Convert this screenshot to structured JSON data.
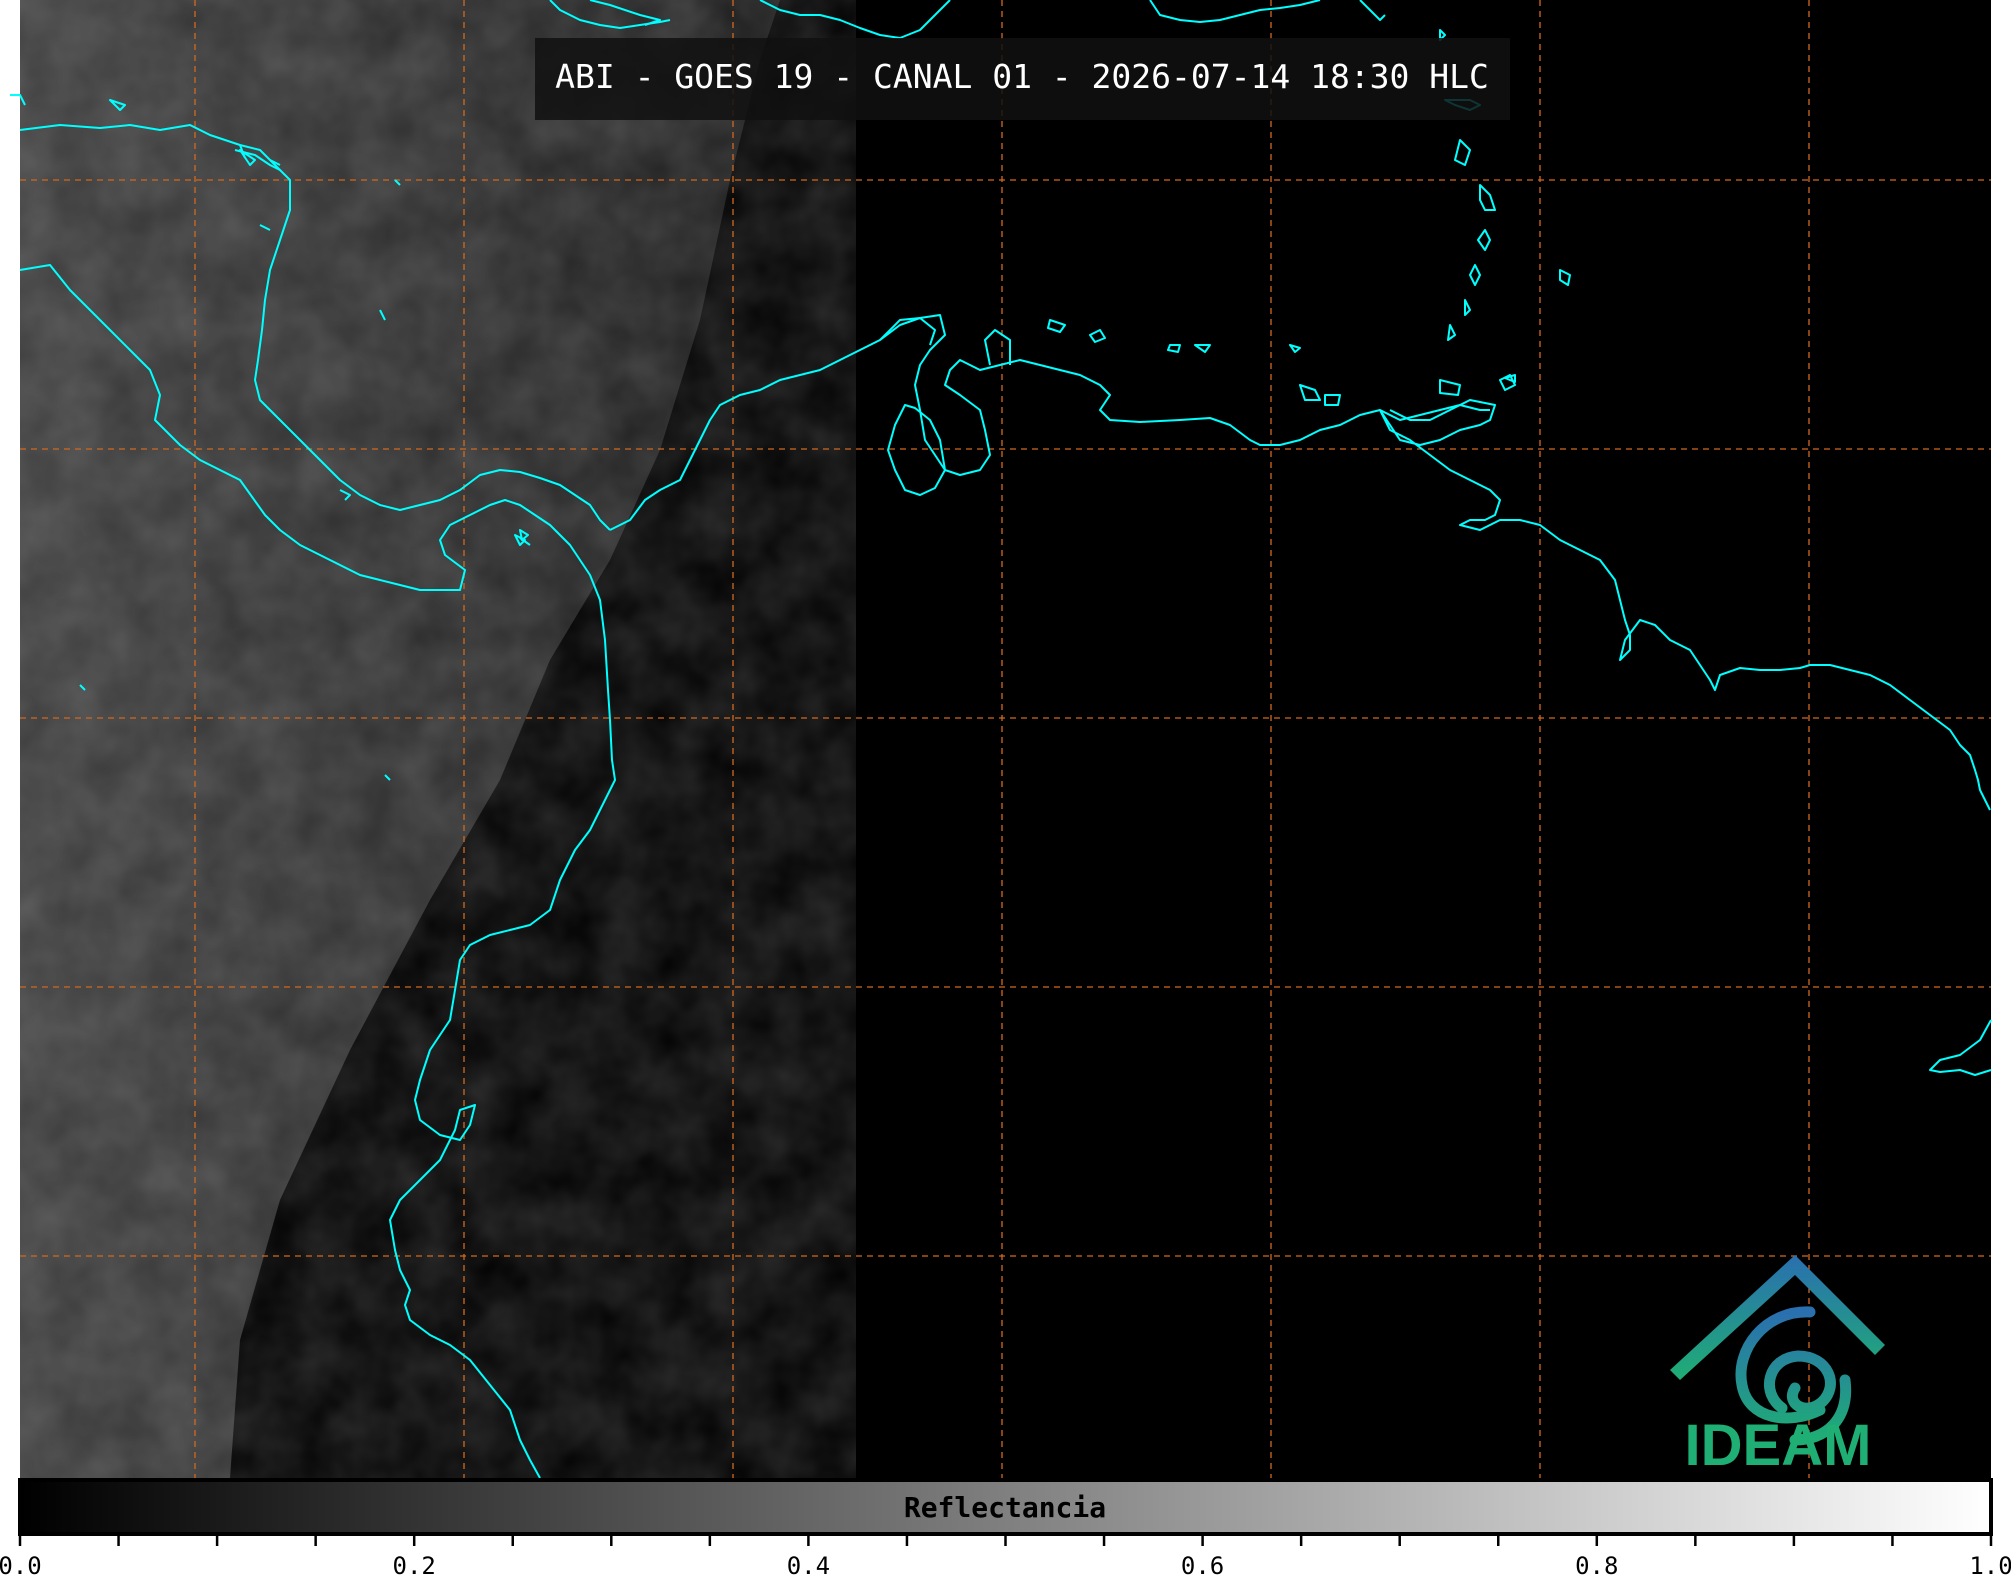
{
  "title": "ABI - GOES 19 - CANAL 01 - 2026-07-14 18:30 HLC",
  "logo": {
    "text": "IDEAM",
    "colors": {
      "top": "#2a6fb0",
      "bottom": "#1fae74"
    }
  },
  "colorbar": {
    "label": "Reflectancia",
    "range": [
      0.0,
      1.0
    ],
    "ticks": [
      "0.0",
      "0.2",
      "0.4",
      "0.6",
      "0.8",
      "1.0"
    ],
    "tick_values": [
      0.0,
      0.2,
      0.4,
      0.6,
      0.8,
      1.0
    ],
    "minor_step": 0.05
  },
  "colors": {
    "coastline": "#00ffff",
    "gridlines": "#d2691e",
    "background": "#000000",
    "frame": "#000000"
  }
}
